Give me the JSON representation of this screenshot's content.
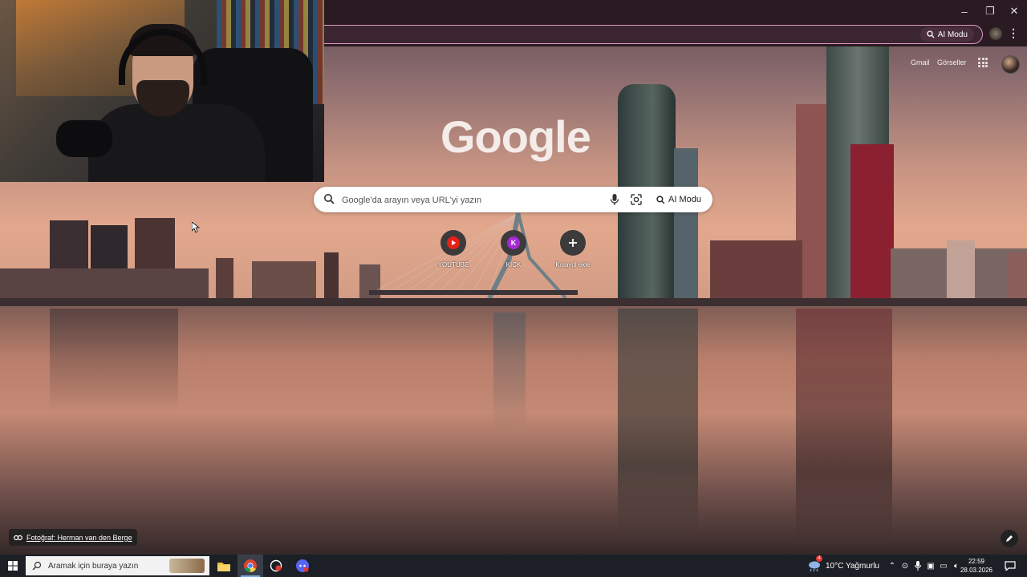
{
  "browser": {
    "ai_mode_label": "AI Modu",
    "window_controls": {
      "minimize": "–",
      "restore": "❐",
      "close": "✕"
    }
  },
  "google": {
    "gmail_label": "Gmail",
    "images_label": "Görseller",
    "logo_text": "Google",
    "search_placeholder": "Google'da arayın veya URL'yi yazın",
    "ai_mode_label": "AI Modu",
    "shortcuts": [
      {
        "label": "YOUTUBE",
        "icon": "youtube-icon",
        "color": "#e62117"
      },
      {
        "label": "KICK",
        "icon": "kick-icon",
        "letter": "K",
        "color": "#a42bd1"
      },
      {
        "label": "Kısayol ekle",
        "icon": "plus-icon"
      }
    ],
    "photo_credit": "Fotoğraf: Herman van den Berge"
  },
  "taskbar": {
    "search_placeholder": "Aramak için buraya yazın",
    "weather_text": "10°C  Yağmurlu",
    "weather_badge": "4",
    "time": "22:59",
    "date": "28.03.2026",
    "apps": [
      "file-explorer",
      "chrome",
      "app-3",
      "discord"
    ]
  },
  "colors": {
    "accent_border": "#e49bc2",
    "youtube": "#e62117",
    "kick": "#a42bd1"
  }
}
